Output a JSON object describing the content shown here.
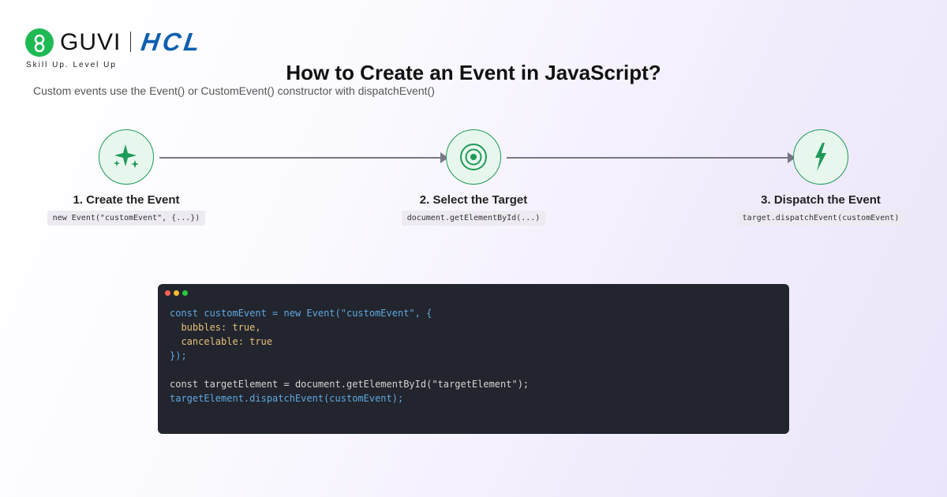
{
  "brand": {
    "guvi": "GUVI",
    "hcl": "HCL",
    "tagline": "Skill Up. Level Up"
  },
  "title": "How to Create an Event in JavaScript?",
  "subtitle": "Custom events use the Event() or CustomEvent() constructor with dispatchEvent()",
  "steps": [
    {
      "title": "1. Create the Event",
      "code": "new Event(\"customEvent\", {...})",
      "icon": "sparkles-icon"
    },
    {
      "title": "2. Select the Target",
      "code": "document.getElementById(...)",
      "icon": "target-icon"
    },
    {
      "title": "3. Dispatch the Event",
      "code": "target.dispatchEvent(customEvent)",
      "icon": "lightning-icon"
    }
  ],
  "code_lines": [
    {
      "text": "const customEvent = new Event(\"customEvent\", {",
      "color": "#5fa8e0"
    },
    {
      "text": "  bubbles: true,",
      "color": "#e5c07b"
    },
    {
      "text": "  cancelable: true",
      "color": "#e5c07b"
    },
    {
      "text": "});",
      "color": "#5fa8e0"
    },
    {
      "text": "",
      "color": "#d4d4d4"
    },
    {
      "text": "const targetElement = document.getElementById(\"targetElement\");",
      "color": "#d4d4d4"
    },
    {
      "text": "targetElement.dispatchEvent(customEvent);",
      "color": "#5fa8e0"
    }
  ],
  "colors": {
    "accent_green": "#1e9a58",
    "guvi_green": "#1fb954",
    "hcl_blue": "#0f5fb0",
    "window_dots": [
      "#ff5f57",
      "#febc2e",
      "#28c840"
    ]
  }
}
